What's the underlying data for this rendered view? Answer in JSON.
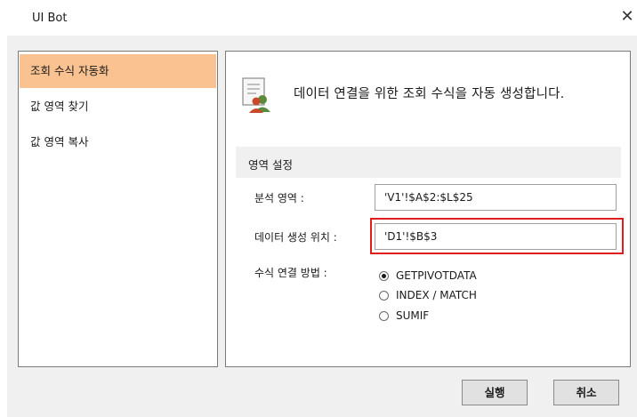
{
  "window": {
    "title": "UI Bot",
    "close_glyph": "✕"
  },
  "sidebar": {
    "items": [
      {
        "label": "조회 수식 자동화",
        "selected": true
      },
      {
        "label": "값 영역 찾기",
        "selected": false
      },
      {
        "label": "값 영역 복사",
        "selected": false
      }
    ]
  },
  "main": {
    "header_text": "데이터 연결을 위한 조회 수식을 자동 생성합니다.",
    "icon": "document-users-icon",
    "section_title": "영역 설정",
    "analysis_range": {
      "label": "분석 영역 :",
      "value": "'V1'!$A$2:$L$25"
    },
    "data_position": {
      "label": "데이터 생성 위치 :",
      "value": "'D1'!$B$3"
    },
    "formula_method": {
      "label": "수식 연결 방법 :",
      "options": [
        {
          "label": "GETPIVOTDATA",
          "checked": true
        },
        {
          "label": "INDEX / MATCH",
          "checked": false
        },
        {
          "label": "SUMIF",
          "checked": false
        }
      ]
    }
  },
  "footer": {
    "run_label": "실행",
    "cancel_label": "취소"
  },
  "colors": {
    "selected_nav": "#fac291",
    "highlight_border": "#e11d1d",
    "dialog_bg": "#f0f0f0"
  }
}
